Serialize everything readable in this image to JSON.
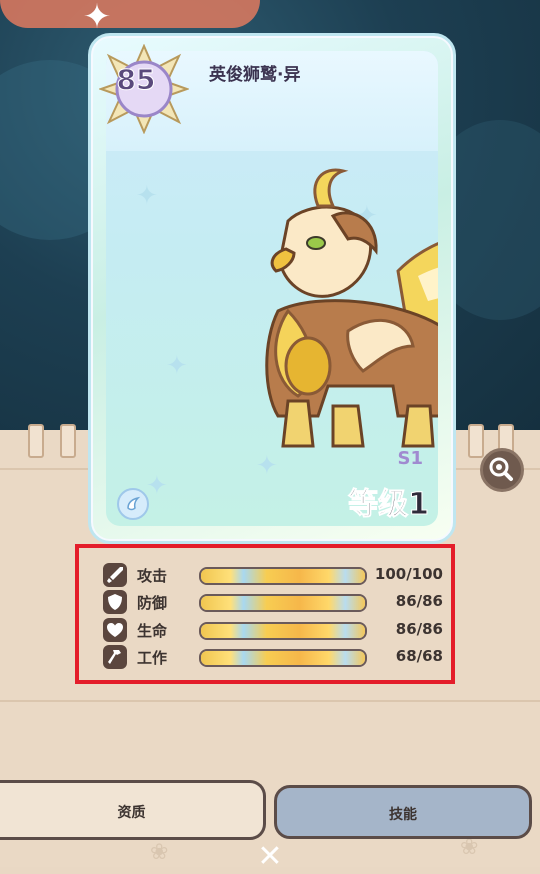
{
  "card": {
    "level": "85",
    "name": "英俊狮鹫·异",
    "season": "S1",
    "rank": "等级1"
  },
  "stats": [
    {
      "label": "攻击",
      "value": "100/100",
      "fill": 1.0,
      "icon": "sword-icon"
    },
    {
      "label": "防御",
      "value": "86/86",
      "fill": 1.0,
      "icon": "shield-icon"
    },
    {
      "label": "生命",
      "value": "86/86",
      "fill": 1.0,
      "icon": "heart-icon"
    },
    {
      "label": "工作",
      "value": "68/68",
      "fill": 1.0,
      "icon": "hammer-icon"
    }
  ],
  "tabs": {
    "qualities": "资质",
    "skills": "技能"
  },
  "colors": {
    "highlight_border": "#e41d2a",
    "card_frame": "#bfe6f0",
    "tab_active": "#f1e4d4",
    "tab_inactive": "#a5b5c9"
  },
  "icons": {
    "zoom": "magnifier-icon",
    "element": "wind-element-icon",
    "close": "close-icon",
    "sparkle": "sparkle-icon"
  }
}
